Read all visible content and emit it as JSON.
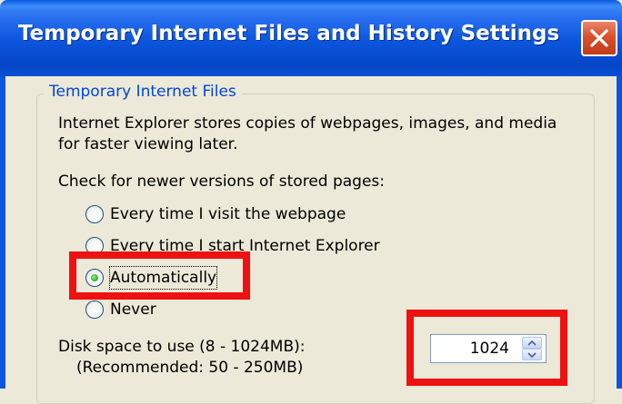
{
  "window": {
    "title": "Temporary Internet Files and History Settings"
  },
  "group": {
    "legend": "Temporary Internet Files",
    "description_line1": "Internet Explorer stores copies of webpages, images, and media",
    "description_line2": "for faster viewing later.",
    "check_label": "Check for newer versions of stored pages:"
  },
  "options": [
    {
      "label": "Every time I visit the webpage",
      "selected": false
    },
    {
      "label": "Every time I start Internet Explorer",
      "selected": false
    },
    {
      "label": "Automatically",
      "selected": true
    },
    {
      "label": "Never",
      "selected": false
    }
  ],
  "disk": {
    "label_line1": "Disk space to use (8 - 1024MB):",
    "label_line2": "(Recommended: 50 - 250MB)",
    "value": "1024"
  },
  "colors": {
    "titlebar": "#0b55dc",
    "close_button": "#d9502d",
    "highlight": "#ee1111",
    "legend_text": "#0046d5",
    "dialog_background": "#ece9d8"
  }
}
